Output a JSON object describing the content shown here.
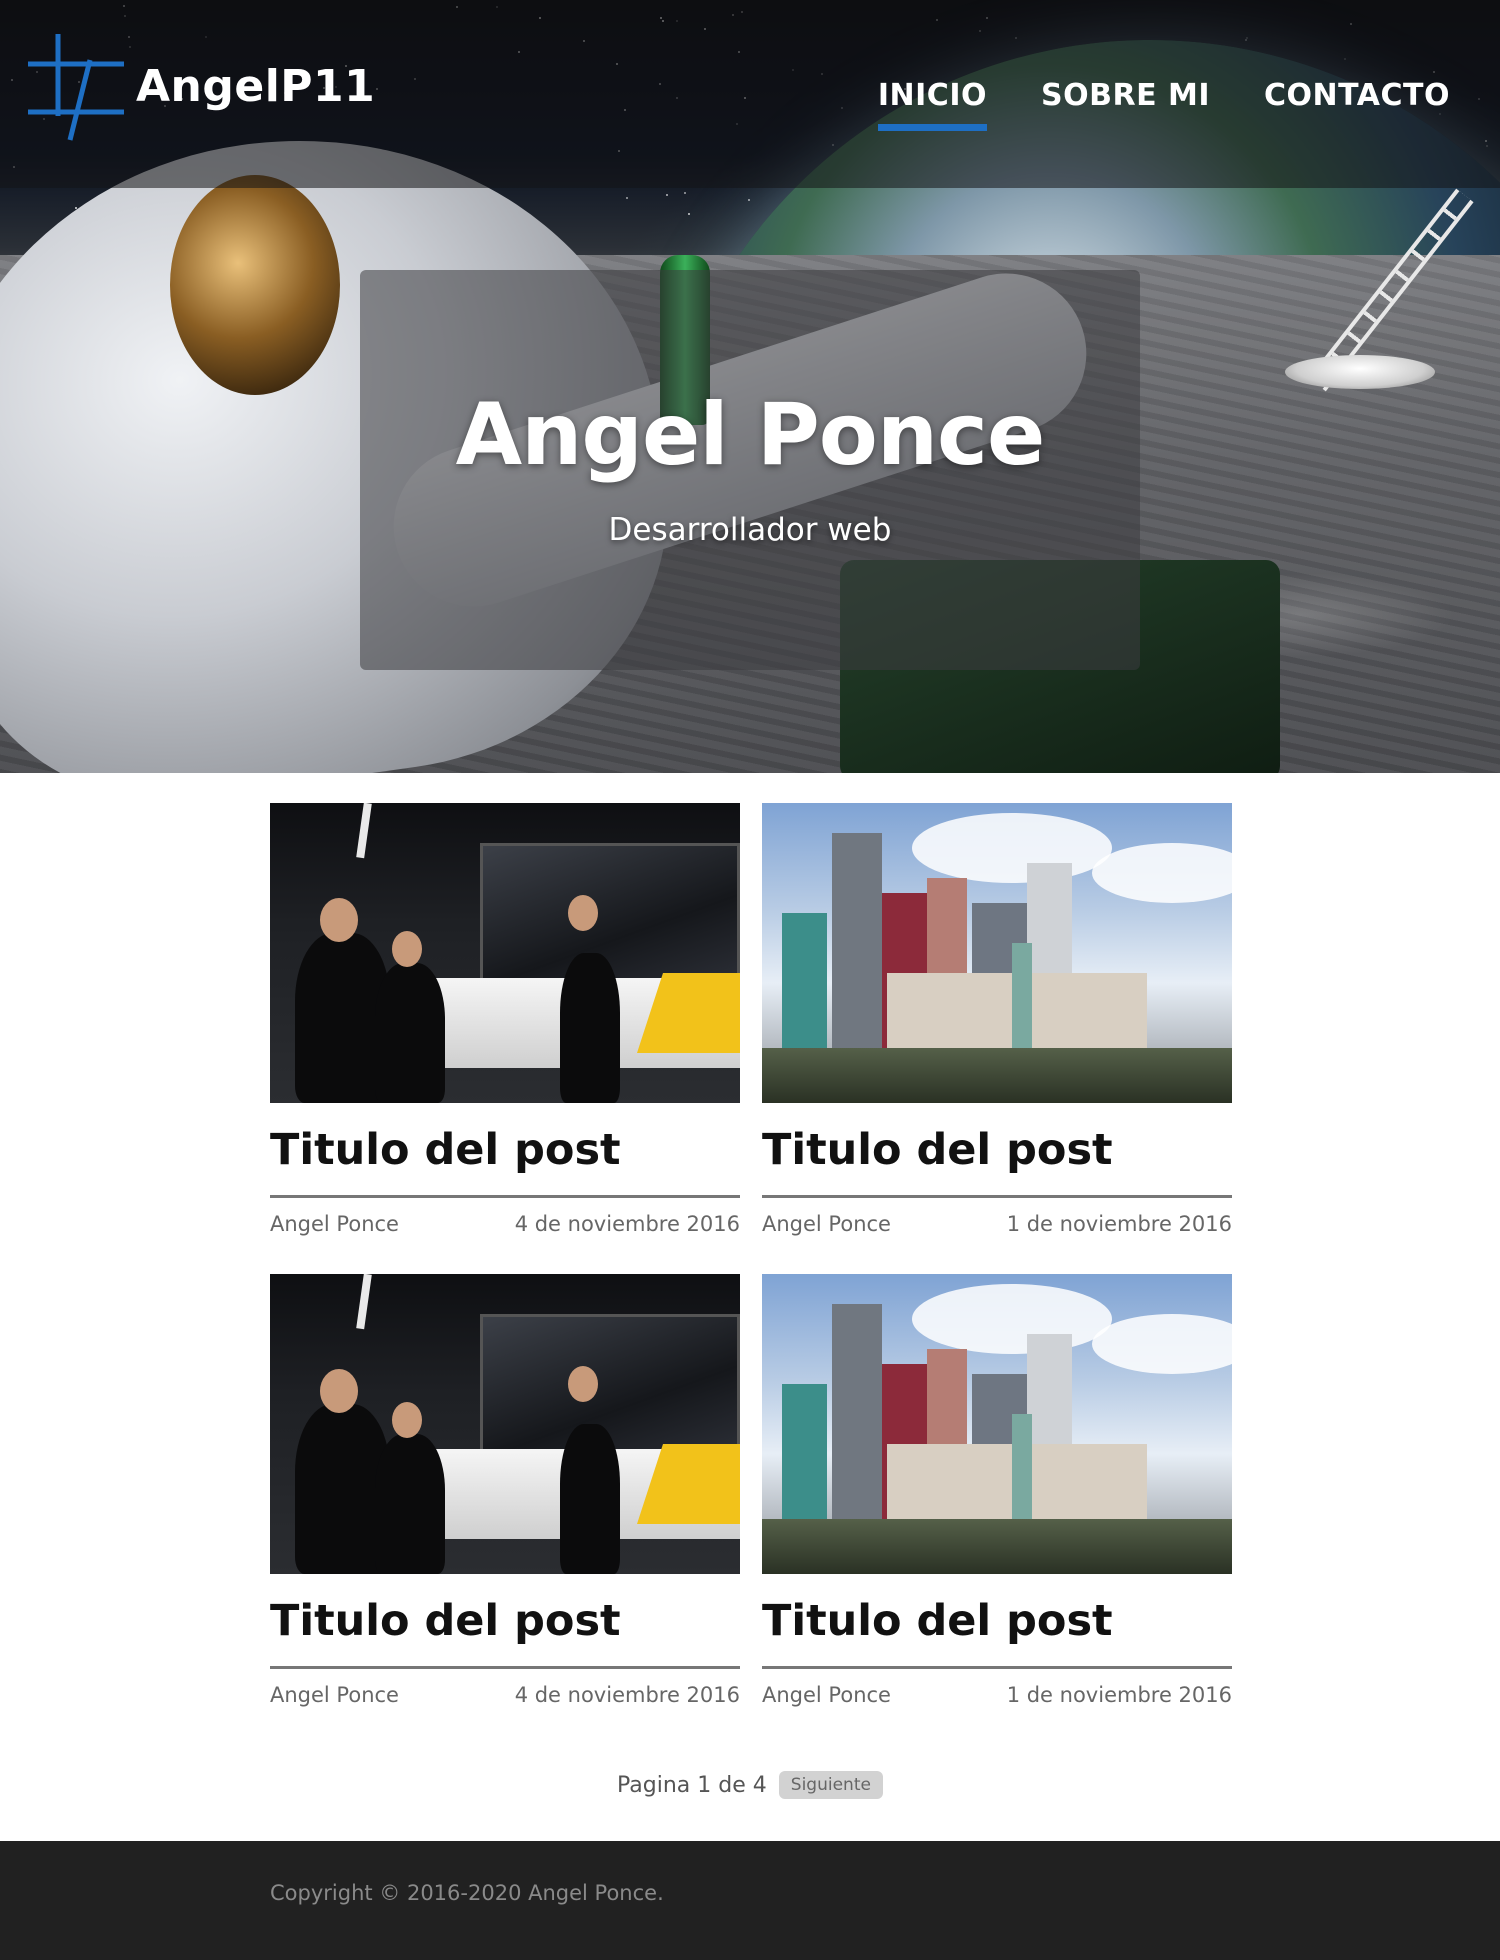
{
  "header": {
    "brand_name": "AngelP11",
    "logo_icon": "logo-grid-icon",
    "accent_color": "#1e6fc4",
    "nav": [
      {
        "label": "INICIO",
        "active": true
      },
      {
        "label": "SOBRE MI",
        "active": false
      },
      {
        "label": "CONTACTO",
        "active": false
      }
    ]
  },
  "hero": {
    "title": "Angel Ponce",
    "subtitle": "Desarrollador web"
  },
  "posts": [
    {
      "title": "Titulo del post",
      "author": "Angel Ponce",
      "date": "4 de noviembre 2016",
      "image": "bar-scene-image"
    },
    {
      "title": "Titulo del post",
      "author": "Angel Ponce",
      "date": "1 de noviembre 2016",
      "image": "city-skyline-image"
    },
    {
      "title": "Titulo del post",
      "author": "Angel Ponce",
      "date": "4 de noviembre 2016",
      "image": "bar-scene-image"
    },
    {
      "title": "Titulo del post",
      "author": "Angel Ponce",
      "date": "1 de noviembre 2016",
      "image": "city-skyline-image"
    }
  ],
  "pagination": {
    "info": "Pagina 1 de 4",
    "next_label": "Siguiente"
  },
  "footer": {
    "copyright": "Copyright © 2016-2020 Angel Ponce.",
    "background_color": "#212121"
  }
}
